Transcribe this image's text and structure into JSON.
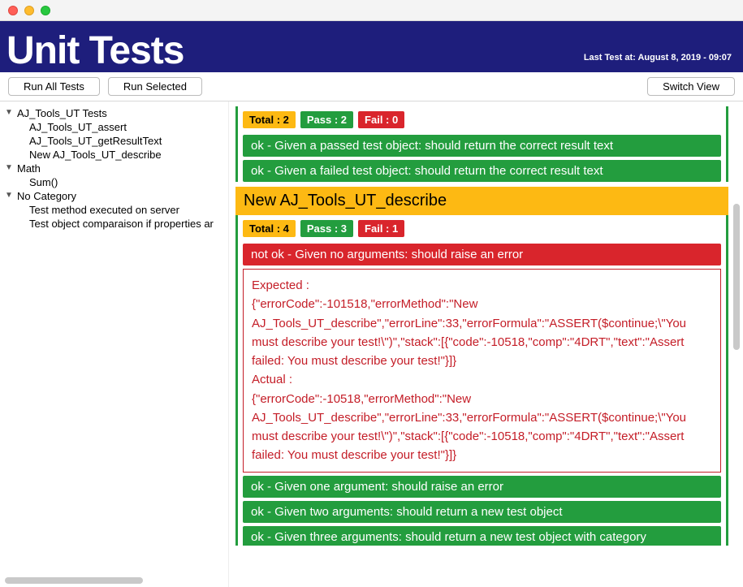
{
  "header": {
    "title": "Unit Tests",
    "last_test_label": "Last Test at: August 8, 2019 - 09:07"
  },
  "toolbar": {
    "run_all": "Run All Tests",
    "run_selected": "Run Selected",
    "switch_view": "Switch View"
  },
  "sidebar": {
    "groups": [
      {
        "label": "AJ_Tools_UT Tests",
        "items": [
          "AJ_Tools_UT_assert",
          "AJ_Tools_UT_getResultText",
          "New AJ_Tools_UT_describe"
        ]
      },
      {
        "label": "Math",
        "items": [
          "Sum()"
        ]
      },
      {
        "label": "No Category",
        "items": [
          "Test method executed on server",
          "Test object comparaison if properties ar"
        ]
      }
    ]
  },
  "prev_suite": {
    "total": "Total : 2",
    "pass": "Pass : 2",
    "fail": "Fail : 0",
    "results": [
      "ok - Given a passed test object: should return the correct result text",
      "ok - Given a failed test object: should return the correct result text"
    ]
  },
  "suite": {
    "title": "New AJ_Tools_UT_describe",
    "total": "Total : 4",
    "pass": "Pass : 3",
    "fail": "Fail : 1",
    "fail_line": "not ok - Given no arguments: should raise an error",
    "detail_expected_label": "Expected :",
    "detail_expected_body": "{\"errorCode\":-101518,\"errorMethod\":\"New AJ_Tools_UT_describe\",\"errorLine\":33,\"errorFormula\":\"ASSERT($continue;\\\"You must describe your test!\\\")\",\"stack\":[{\"code\":-10518,\"comp\":\"4DRT\",\"text\":\"Assert failed: You must describe your test!\"}]}",
    "detail_actual_label": "Actual :",
    "detail_actual_body": "{\"errorCode\":-10518,\"errorMethod\":\"New AJ_Tools_UT_describe\",\"errorLine\":33,\"errorFormula\":\"ASSERT($continue;\\\"You must describe your test!\\\")\",\"stack\":[{\"code\":-10518,\"comp\":\"4DRT\",\"text\":\"Assert failed: You must describe your test!\"}]}",
    "ok_results": [
      "ok - Given one argument: should raise an error",
      "ok - Given two arguments: should return a new test object",
      "ok - Given three arguments: should return a new test object with category"
    ]
  }
}
